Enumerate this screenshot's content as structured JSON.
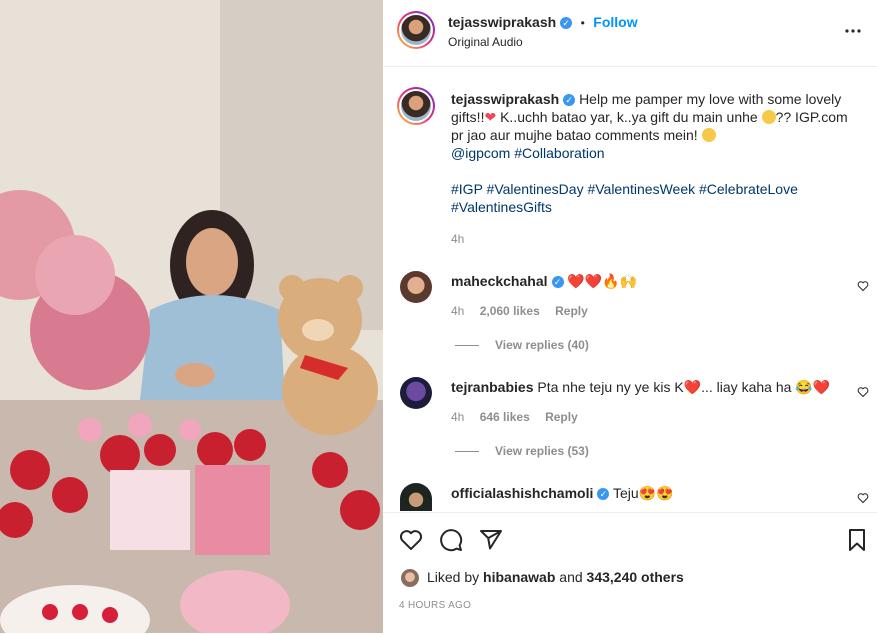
{
  "header": {
    "username": "tejasswiprakash",
    "verified": true,
    "follow_label": "Follow",
    "separator": "•",
    "audio": "Original Audio",
    "more_icon": "more-horizontal-icon"
  },
  "caption": {
    "username": "tejasswiprakash",
    "text_1": "Help me pamper my love with some lovely gifts!!",
    "text_2": " K..uchh batao yar, k..ya gift du main unhe ",
    "text_3": "?? IGP.com pr jao aur mujhe batao comments mein! ",
    "mention": "@igpcom",
    "hashtag_collab": "#Collaboration",
    "hashtags": "#IGP #ValentinesDay #ValentinesWeek #CelebrateLove #ValentinesGifts",
    "time": "4h"
  },
  "comments": [
    {
      "username": "maheckchahal",
      "verified": true,
      "text": "❤️❤️🔥🙌",
      "time": "4h",
      "likes": "2,060 likes",
      "reply": "Reply",
      "view_replies": "View replies (40)"
    },
    {
      "username": "tejranbabies",
      "verified": false,
      "text": "Pta nhe teju ny ye kis K❤️... liay kaha ha 😂❤️",
      "time": "4h",
      "likes": "646 likes",
      "reply": "Reply",
      "view_replies": "View replies (53)"
    },
    {
      "username": "officialashishchamoli",
      "verified": true,
      "text": "Teju😍😍"
    }
  ],
  "actions": {
    "like_icon": "heart-icon",
    "comment_icon": "comment-icon",
    "share_icon": "send-icon",
    "save_icon": "bookmark-icon"
  },
  "likes": {
    "prefix": "Liked by ",
    "user": "hibanawab",
    "middle": " and ",
    "count": "343,240 others"
  },
  "post_time": "4 HOURS AGO",
  "colors": {
    "follow": "#0095f6",
    "verified": "#3897f0",
    "link": "#00376b",
    "muted": "#8e8e8e"
  }
}
